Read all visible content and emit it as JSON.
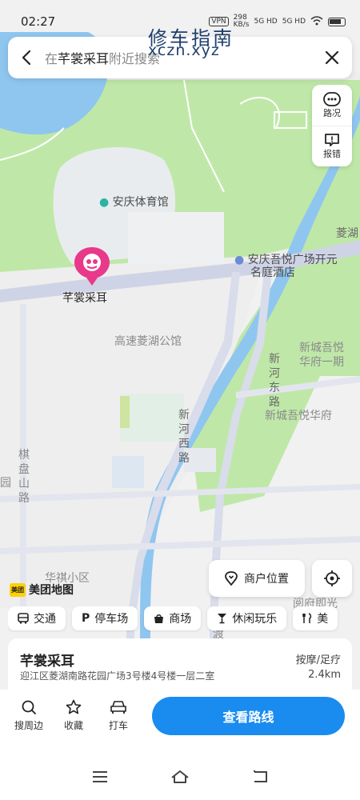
{
  "status_bar": {
    "time": "02:27",
    "vpn": "VPN",
    "speed": "298",
    "speed_unit": "KB/s",
    "signal1": "5G HD",
    "signal2": "5G HD",
    "watermark_title": "修车指南",
    "watermark_url": "xczn.xyz"
  },
  "search": {
    "prefix": "在",
    "keyword": "芊裳采耳",
    "suffix": "附近搜索"
  },
  "side_tools": {
    "traffic": "路况",
    "report": "报错"
  },
  "map": {
    "labels": {
      "stadium": "安庆体育馆",
      "hotel_line1": "安庆吾悦广场开元",
      "hotel_line2": "名庭酒店",
      "gaosu": "高速菱湖公馆",
      "xincheng1_line1": "新城吾悦",
      "xincheng1_line2": "华府一期",
      "xincheng2": "新城吾悦华府",
      "qipan": "棋盘山路",
      "xinhe_east": "新河东路",
      "xinhe_west": "新河西路",
      "linghu": "菱湖",
      "huaqi": "华祺小区",
      "du": "渡",
      "yuan": "园",
      "bottom_right": "阅府即光"
    },
    "marker_name": "芊裳采耳"
  },
  "branding": {
    "badge": "美团",
    "text": "美团地图"
  },
  "buttons": {
    "merchant_location": "商户位置"
  },
  "chips": [
    {
      "label": "交通",
      "icon": "bus-icon"
    },
    {
      "label": "停车场",
      "icon": "parking-icon"
    },
    {
      "label": "商场",
      "icon": "shopping-bag-icon"
    },
    {
      "label": "休闲玩乐",
      "icon": "cocktail-icon"
    },
    {
      "label": "美",
      "icon": "cutlery-icon"
    }
  ],
  "merchant": {
    "name": "芊裳采耳",
    "category": "按摩/足疗",
    "address": "迎江区菱湖南路花园广场3号楼4号楼一层二室",
    "distance": "2.4km"
  },
  "actions": {
    "search_nearby": "搜周边",
    "favorite": "收藏",
    "taxi": "打车",
    "route": "查看路线"
  },
  "colors": {
    "accent": "#1a8cf0",
    "marker": "#e8398a",
    "water": "#8fc6f0",
    "park": "#bfe8a8",
    "road": "#cfd3e6"
  }
}
